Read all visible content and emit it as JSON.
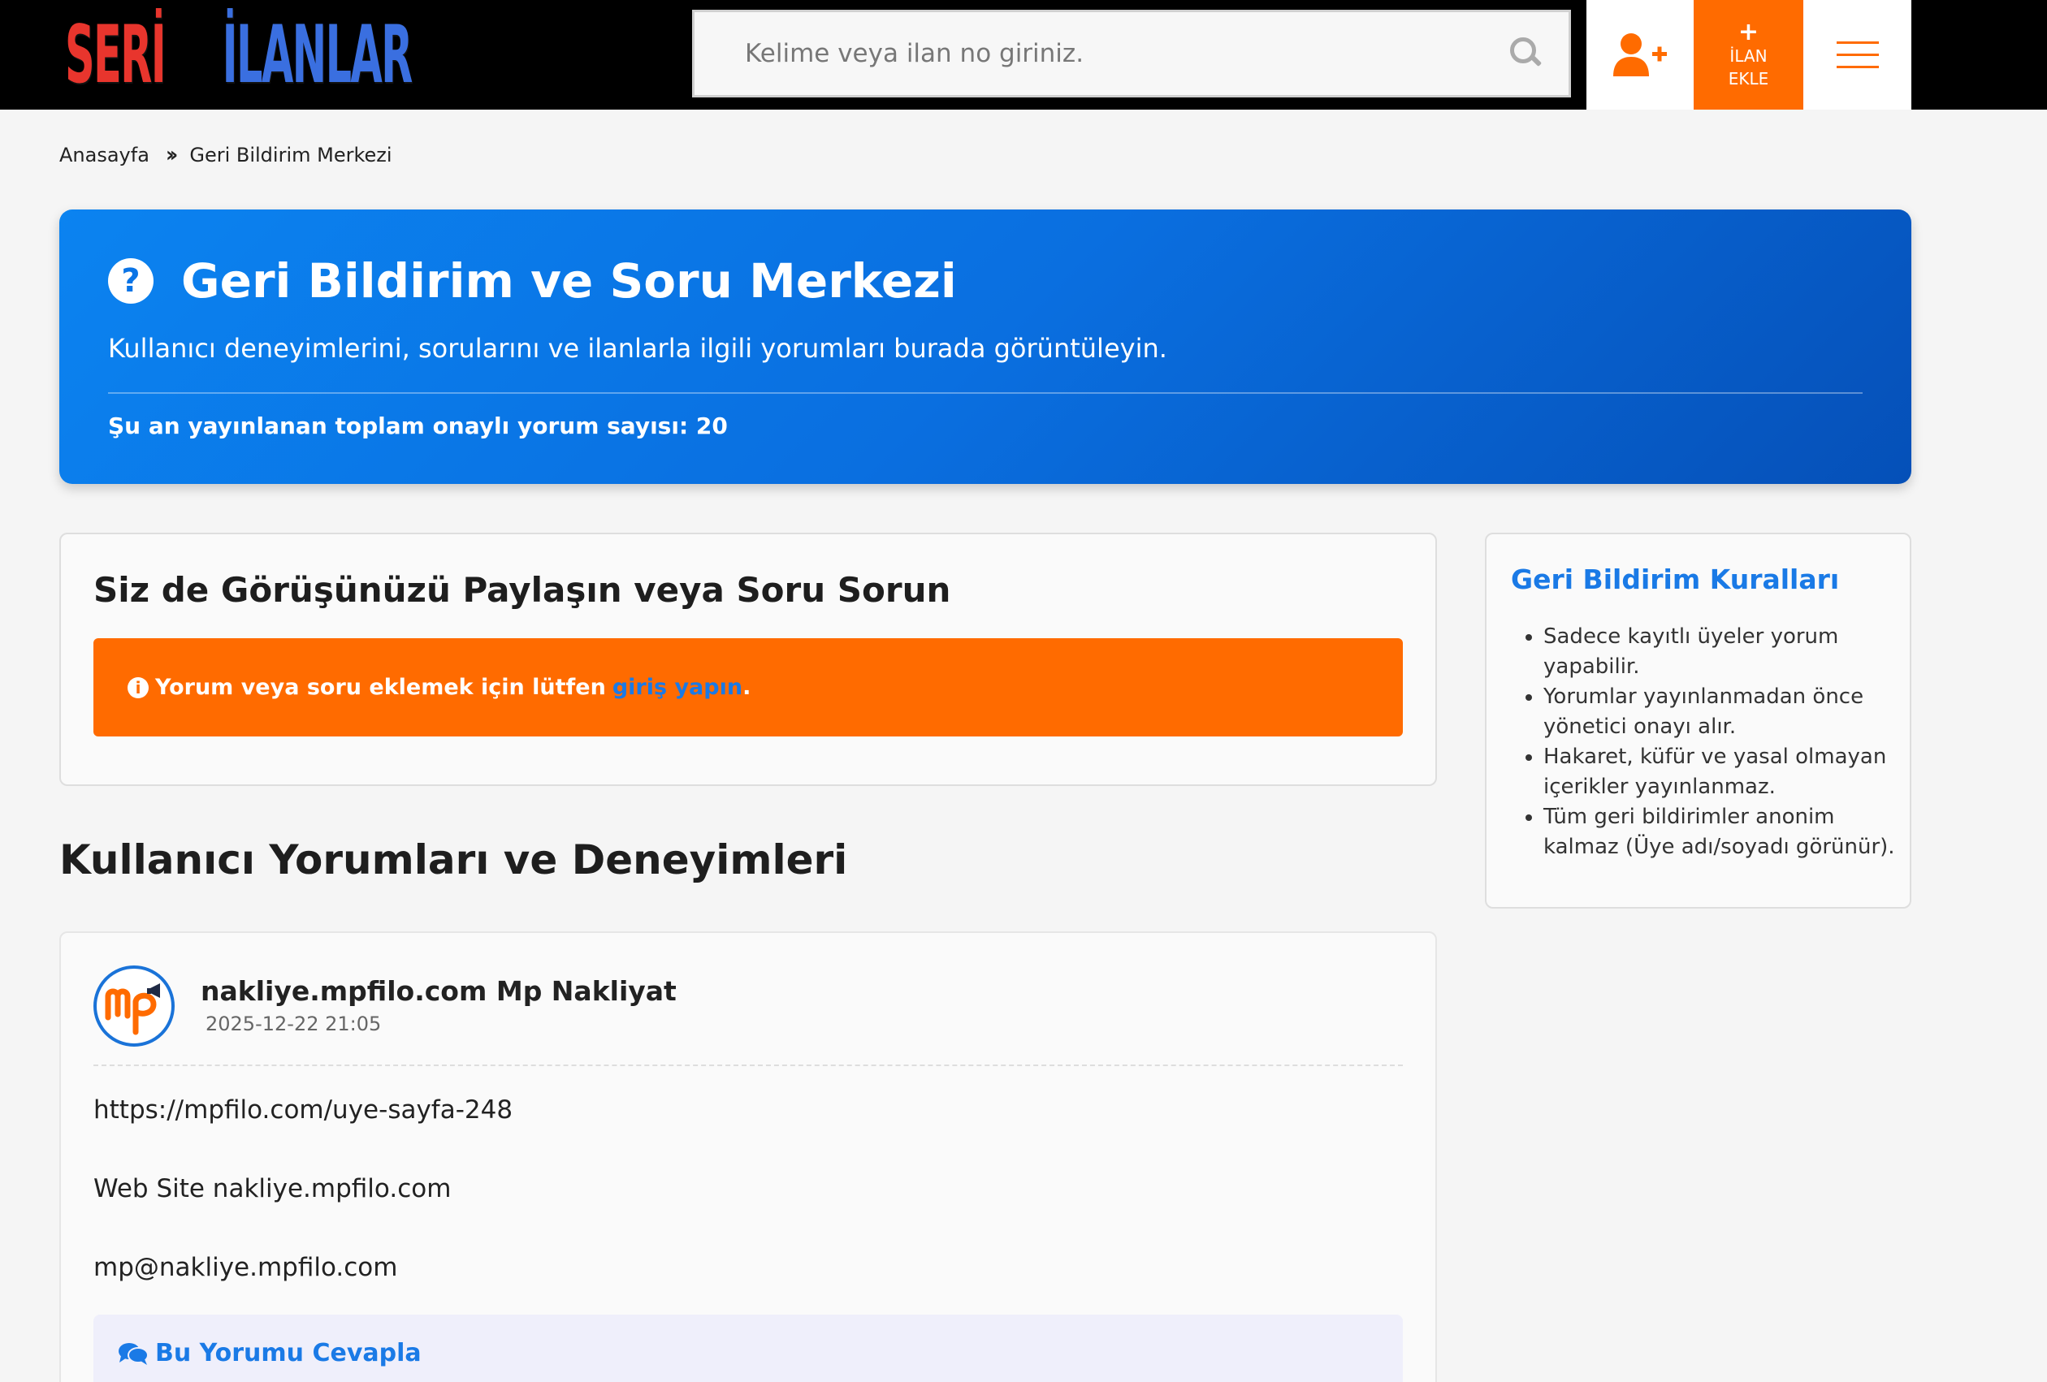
{
  "header": {
    "logo_part1": "SERİ",
    "logo_part2": "İLANLAR",
    "search_placeholder": "Kelime veya ilan no giriniz.",
    "add_plus": "+",
    "add_line1": "İLAN",
    "add_line2": "EKLE",
    "icons": {
      "search": "search-icon",
      "user": "user-plus-icon",
      "menu": "hamburger-icon"
    },
    "accent_color": "#ff6b00"
  },
  "breadcrumb": {
    "home": "Anasayfa",
    "current": "Geri Bildirim Merkezi"
  },
  "hero": {
    "title": "Geri Bildirim ve Soru Merkezi",
    "subtitle": "Kullanıcı deneyimlerini, sorularını ve ilanlarla ilgili yorumları burada görüntüleyin.",
    "count_text": "Şu an yayınlanan toplam onaylı yorum sayısı: 20",
    "icon": "question-circle-icon",
    "color": "#0a74e6"
  },
  "share": {
    "title": "Siz de Görüşünüzü Paylaşın veya Soru Sorun",
    "alert_text": "Yorum veya soru eklemek için lütfen",
    "alert_link": "giriş yapın",
    "alert_end": ".",
    "alert_color": "#ff6b00"
  },
  "comments_section": {
    "title": "Kullanıcı Yorumları ve Deneyimleri",
    "items": [
      {
        "name": "nakliye.mpfilo.com Mp Nakliyat",
        "date": "2025-12-22 21:05",
        "lines": [
          "https://mpfilo.com/uye-sayfa-248",
          "Web Site nakliye.mpfilo.com",
          "mp@nakliye.mpfilo.com"
        ],
        "reply_label": "Bu Yorumu Cevapla"
      }
    ]
  },
  "rules": {
    "title": "Geri Bildirim Kuralları",
    "items": [
      "Sadece kayıtlı üyeler yorum yapabilir.",
      "Yorumlar yayınlanmadan önce yönetici onayı alır.",
      "Hakaret, küfür ve yasal olmayan içerikler yayınlanmaz.",
      "Tüm geri bildirimler anonim kalmaz (Üye adı/soyadı görünür)."
    ]
  }
}
